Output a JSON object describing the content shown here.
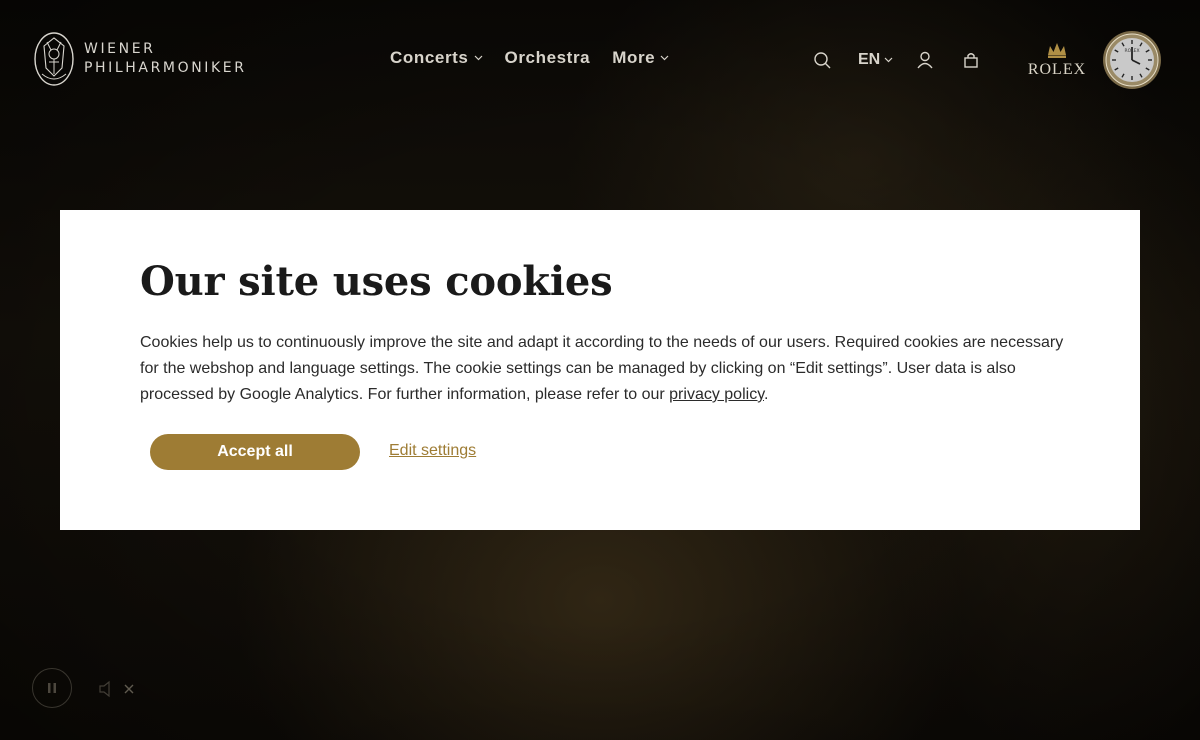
{
  "brand": {
    "logo_line1": "WIENER",
    "logo_line2": "PHILHARMONIKER",
    "logo_icon": "philharmonic-crest-icon"
  },
  "nav": {
    "items": [
      {
        "label": "Concerts",
        "has_dropdown": true
      },
      {
        "label": "Orchestra",
        "has_dropdown": false
      },
      {
        "label": "More",
        "has_dropdown": true
      }
    ]
  },
  "tools": {
    "search_icon": "search-icon",
    "language": "EN",
    "account_icon": "user-icon",
    "cart_icon": "bag-icon"
  },
  "sponsor": {
    "name": "ROLEX",
    "clock_label": "ROLEX"
  },
  "cookie": {
    "title": "Our site uses cookies",
    "text_before_link": "Cookies help us to continuously improve the site and adapt it according to the needs of our users. Required cookies are necessary for the webshop and language settings. The cookie settings can be managed by clicking on “Edit settings”. User data is also processed by Google Analytics. For further information, please refer to our ",
    "link_label": "privacy policy",
    "text_after_link": ".",
    "accept_label": "Accept all",
    "edit_label": "Edit settings"
  },
  "video_controls": {
    "pause_icon": "pause-icon",
    "mute_icon": "mute-icon"
  },
  "colors": {
    "accent": "#9e7c34",
    "background": "#0c0a06",
    "nav_text": "#d8d4cb",
    "modal_bg": "#ffffff"
  }
}
